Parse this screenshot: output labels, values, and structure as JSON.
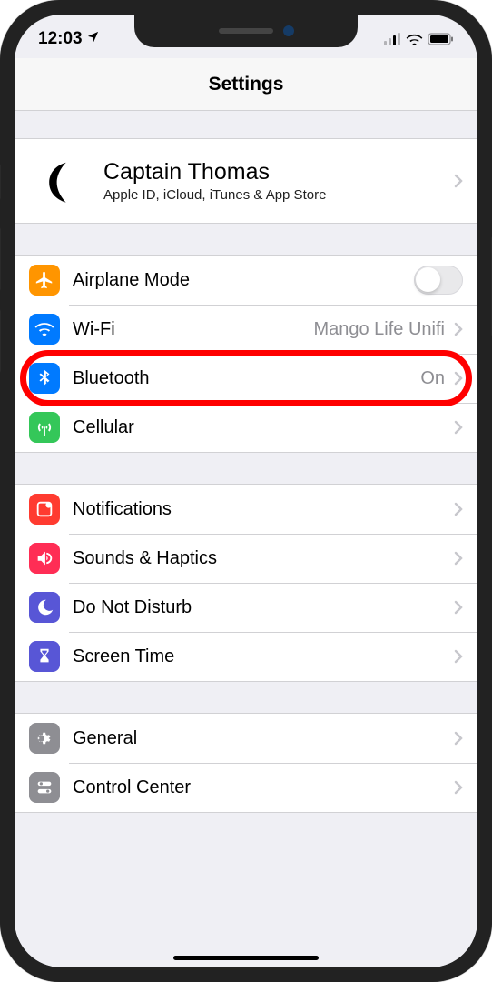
{
  "status": {
    "time": "12:03",
    "location_icon": "location-arrow",
    "cell_signal": 2,
    "wifi": true,
    "battery": "full"
  },
  "header": {
    "title": "Settings"
  },
  "profile": {
    "name": "Captain Thomas",
    "subtitle": "Apple ID, iCloud, iTunes & App Store",
    "avatar_icon": "moon-crescent"
  },
  "groups": [
    {
      "items": [
        {
          "id": "airplane",
          "icon": "airplane-icon",
          "bg": "ic-orange",
          "label": "Airplane Mode",
          "type": "toggle",
          "value": false
        },
        {
          "id": "wifi",
          "icon": "wifi-icon",
          "bg": "ic-blue",
          "label": "Wi-Fi",
          "type": "link",
          "value": "Mango Life Unifi"
        },
        {
          "id": "bluetooth",
          "icon": "bluetooth-icon",
          "bg": "ic-blue",
          "label": "Bluetooth",
          "type": "link",
          "value": "On",
          "highlight": true
        },
        {
          "id": "cellular",
          "icon": "cellular-icon",
          "bg": "ic-green",
          "label": "Cellular",
          "type": "link",
          "value": ""
        }
      ]
    },
    {
      "items": [
        {
          "id": "notifications",
          "icon": "notifications-icon",
          "bg": "ic-red",
          "label": "Notifications",
          "type": "link",
          "value": ""
        },
        {
          "id": "sounds",
          "icon": "sounds-icon",
          "bg": "ic-pink",
          "label": "Sounds & Haptics",
          "type": "link",
          "value": ""
        },
        {
          "id": "dnd",
          "icon": "moon-icon",
          "bg": "ic-purple",
          "label": "Do Not Disturb",
          "type": "link",
          "value": ""
        },
        {
          "id": "screentime",
          "icon": "hourglass-icon",
          "bg": "ic-purple",
          "label": "Screen Time",
          "type": "link",
          "value": ""
        }
      ]
    },
    {
      "items": [
        {
          "id": "general",
          "icon": "gear-icon",
          "bg": "ic-gray",
          "label": "General",
          "type": "link",
          "value": ""
        },
        {
          "id": "controlcenter",
          "icon": "switches-icon",
          "bg": "ic-gray",
          "label": "Control Center",
          "type": "link",
          "value": ""
        }
      ]
    }
  ]
}
